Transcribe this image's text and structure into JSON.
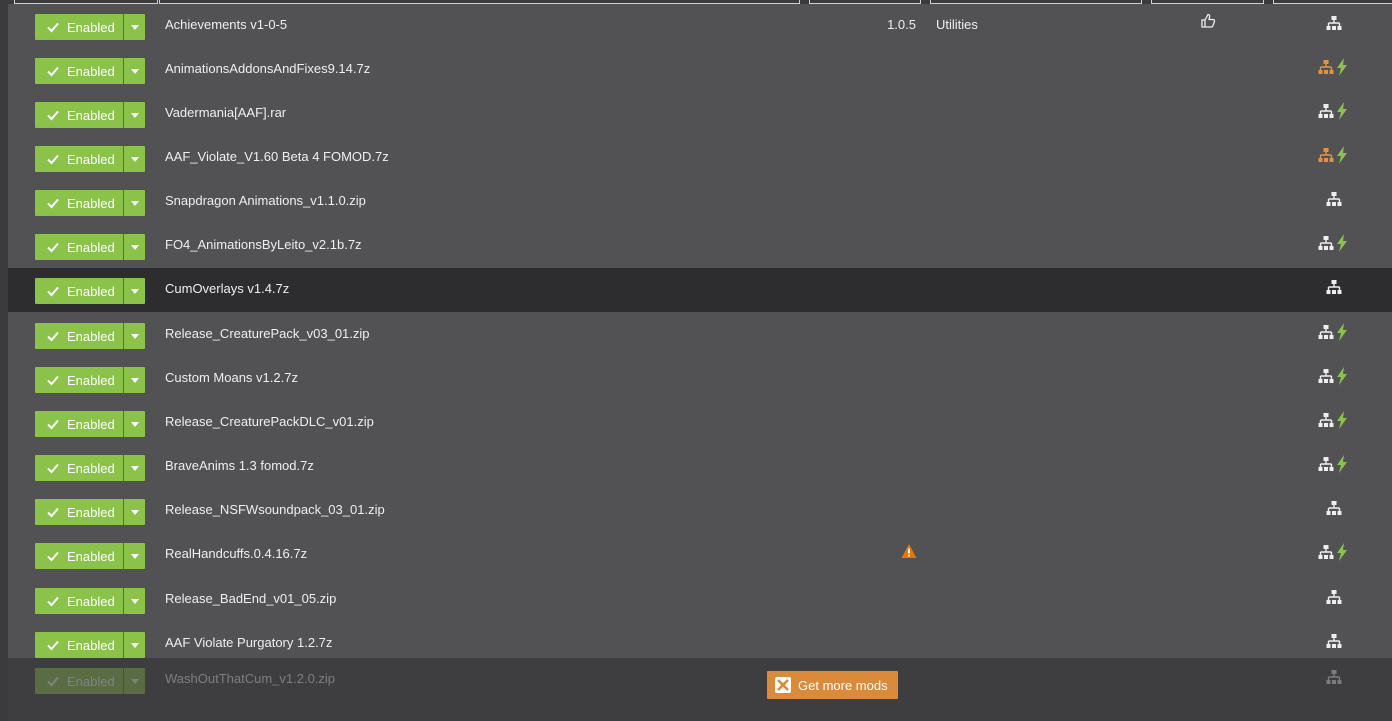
{
  "mods": [
    {
      "status": "Enabled",
      "name": "Achievements v1-0-5",
      "version": "1.0.5",
      "category": "Utilities",
      "endorse": "thumbs-up-icon",
      "deps": "white",
      "lightning": false,
      "warning": false
    },
    {
      "status": "Enabled",
      "name": "AnimationsAddonsAndFixes9.14.7z",
      "version": "",
      "category": "",
      "deps": "orange",
      "lightning": true,
      "warning": false
    },
    {
      "status": "Enabled",
      "name": "Vadermania[AAF].rar",
      "version": "",
      "category": "",
      "deps": "white",
      "lightning": true,
      "warning": false
    },
    {
      "status": "Enabled",
      "name": "AAF_Violate_V1.60 Beta 4 FOMOD.7z",
      "version": "",
      "category": "",
      "deps": "orange",
      "lightning": true,
      "warning": false
    },
    {
      "status": "Enabled",
      "name": "Snapdragon Animations_v1.1.0.zip",
      "version": "",
      "category": "",
      "deps": "white",
      "lightning": false,
      "warning": false
    },
    {
      "status": "Enabled",
      "name": "FO4_AnimationsByLeito_v2.1b.7z",
      "version": "",
      "category": "",
      "deps": "white",
      "lightning": true,
      "warning": false
    },
    {
      "status": "Enabled",
      "name": "CumOverlays v1.4.7z",
      "version": "",
      "category": "",
      "deps": "white",
      "lightning": false,
      "warning": false,
      "selected": true
    },
    {
      "status": "Enabled",
      "name": "Release_CreaturePack_v03_01.zip",
      "version": "",
      "category": "",
      "deps": "white",
      "lightning": true,
      "warning": false
    },
    {
      "status": "Enabled",
      "name": "Custom Moans v1.2.7z",
      "version": "",
      "category": "",
      "deps": "white",
      "lightning": true,
      "warning": false
    },
    {
      "status": "Enabled",
      "name": "Release_CreaturePackDLC_v01.zip",
      "version": "",
      "category": "",
      "deps": "white",
      "lightning": true,
      "warning": false
    },
    {
      "status": "Enabled",
      "name": "BraveAnims 1.3 fomod.7z",
      "version": "",
      "category": "",
      "deps": "white",
      "lightning": true,
      "warning": false
    },
    {
      "status": "Enabled",
      "name": "Release_NSFWsoundpack_03_01.zip",
      "version": "",
      "category": "",
      "deps": "white",
      "lightning": false,
      "warning": false
    },
    {
      "status": "Enabled",
      "name": "RealHandcuffs.0.4.16.7z",
      "version": "",
      "category": "",
      "deps": "white",
      "lightning": true,
      "warning": true
    },
    {
      "status": "Enabled",
      "name": "Release_BadEnd_v01_05.zip",
      "version": "",
      "category": "",
      "deps": "white",
      "lightning": false,
      "warning": false
    },
    {
      "status": "Enabled",
      "name": "AAF Violate Purgatory 1.2.7z",
      "version": "",
      "category": "",
      "deps": "white",
      "lightning": false,
      "warning": false
    },
    {
      "status": "Enabled",
      "name": "WashOutThatCum_v1.2.0.zip",
      "version": "",
      "category": "",
      "deps": "white",
      "lightning": false,
      "warning": false,
      "faded": true
    }
  ],
  "get_more_mods": {
    "label": "Get more mods"
  },
  "colors": {
    "enabled_green": "#8bc34a",
    "accent_orange": "#d98a3b",
    "lightning_green": "#8bc34a",
    "warning_orange": "#e8740c"
  }
}
